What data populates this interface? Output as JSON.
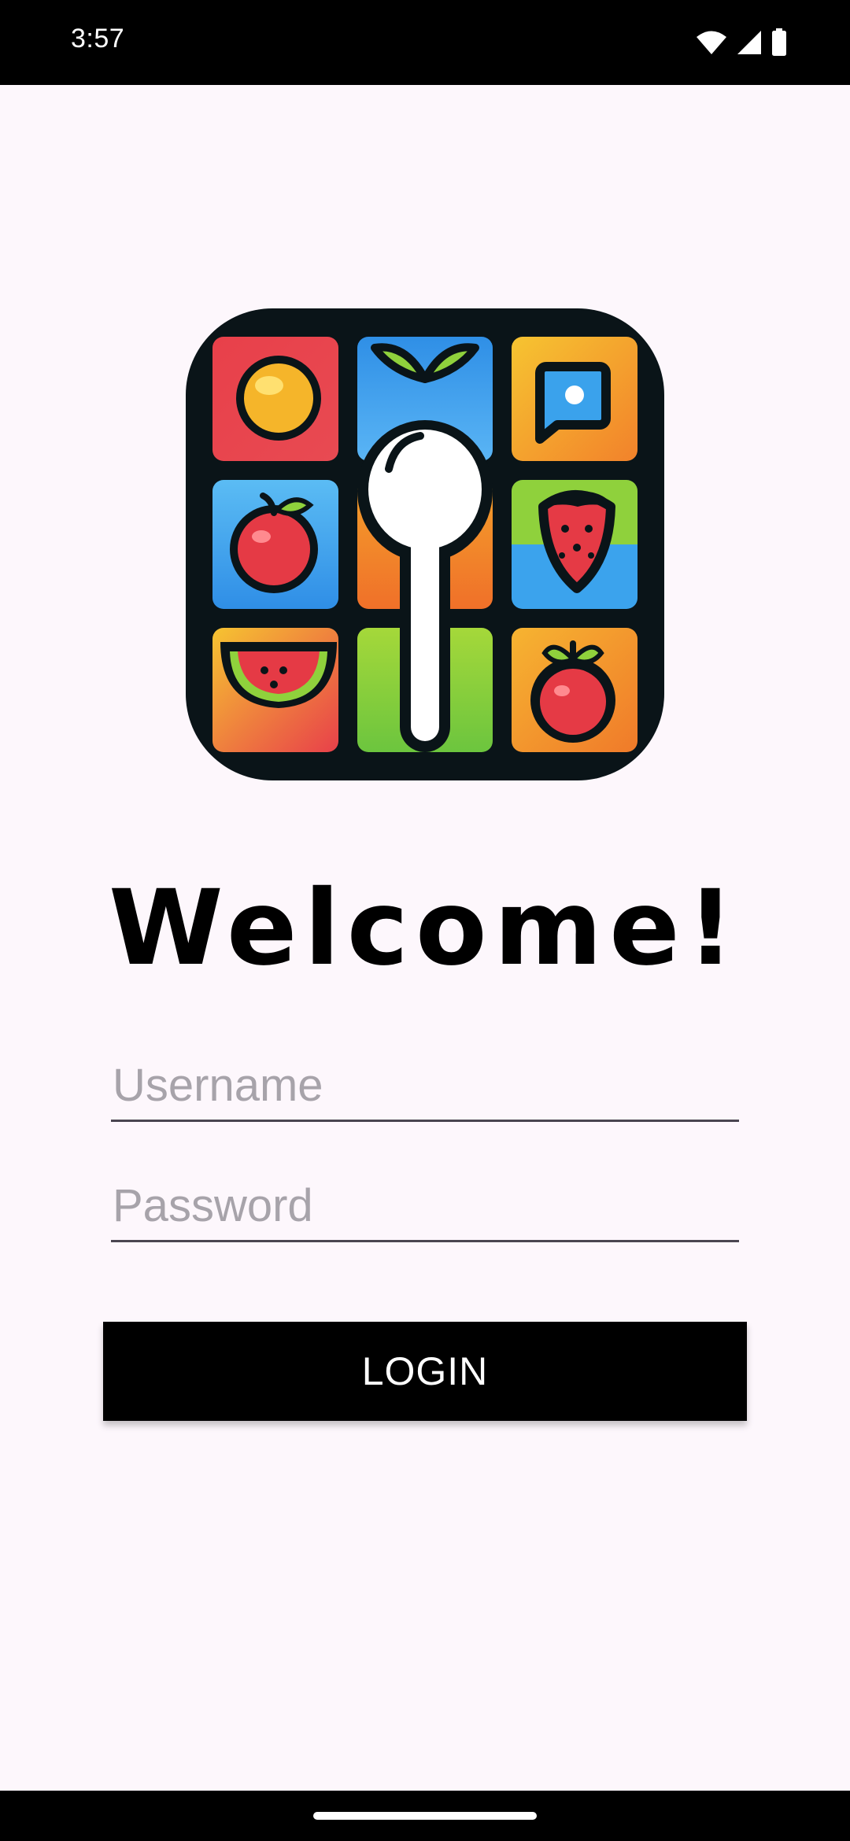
{
  "status_bar": {
    "time": "3:57",
    "icons": [
      "wifi-icon",
      "cell-signal-icon",
      "battery-icon"
    ]
  },
  "logo": {
    "icon": "food-grid-spoon-logo",
    "colors": {
      "frame": "#0a1418",
      "red": "#e8404a",
      "blue": "#3aa2ec",
      "orange": "#f3812a",
      "yellow": "#f5c232",
      "green": "#8fd13c"
    }
  },
  "heading": "Welcome!",
  "form": {
    "username_placeholder": "Username",
    "username_value": "",
    "password_placeholder": "Password",
    "password_value": ""
  },
  "login_button": {
    "label": "LOGIN"
  },
  "theme": {
    "background": "#fdf7fc",
    "button": "#000000",
    "button_text": "#ffffff",
    "placeholder": "#a7a3aa"
  }
}
